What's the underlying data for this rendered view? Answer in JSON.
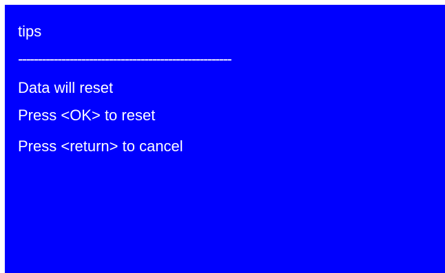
{
  "dialog": {
    "title": "tips",
    "divider": "------------------------------------------------------",
    "lines": [
      "Data will reset",
      "Press <OK> to reset",
      "Press <return> to cancel"
    ]
  },
  "colors": {
    "background": "#0000fe",
    "text": "#ffffff"
  }
}
